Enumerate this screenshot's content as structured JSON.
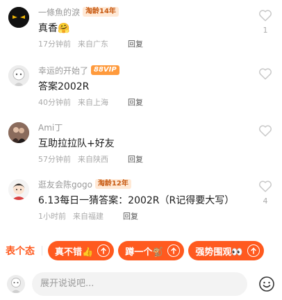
{
  "comments": [
    {
      "name": "一條魚的淚",
      "badge": "淘龄14年",
      "text": "真香🤗",
      "time": "17分钟前",
      "location": "来自广东",
      "reply": "回复",
      "likes": "1"
    },
    {
      "name": "幸运的开始了",
      "badge": "88VIP",
      "text": "答案2002R",
      "time": "40分钟前",
      "location": "来自上海",
      "reply": "回复",
      "likes": ""
    },
    {
      "name": "Ami丁",
      "badge": "",
      "text": "互助拉拉队+好友",
      "time": "57分钟前",
      "location": "来自陕西",
      "reply": "回复",
      "likes": ""
    },
    {
      "name": "逛友会陈gogo",
      "badge": "淘龄12年",
      "text": "6.13每日一猜答案：2002R（R记得要大写）",
      "time": "1小时前",
      "location": "来自福建",
      "reply": "回复",
      "likes": "4"
    }
  ],
  "reactions": {
    "title": "表个态",
    "chips": [
      "真不错👍",
      "蹲一个🐒",
      "强势围观👀"
    ]
  },
  "input": {
    "placeholder": "展开说说吧..."
  },
  "colors": {
    "accent": "#ff5a1f",
    "badge_age_bg": "#ffe9d6",
    "badge_vip_bg": "#ff9a3c"
  },
  "icons": [
    "heart-outline-icon",
    "arrow-up-circle-icon",
    "smile-icon"
  ]
}
